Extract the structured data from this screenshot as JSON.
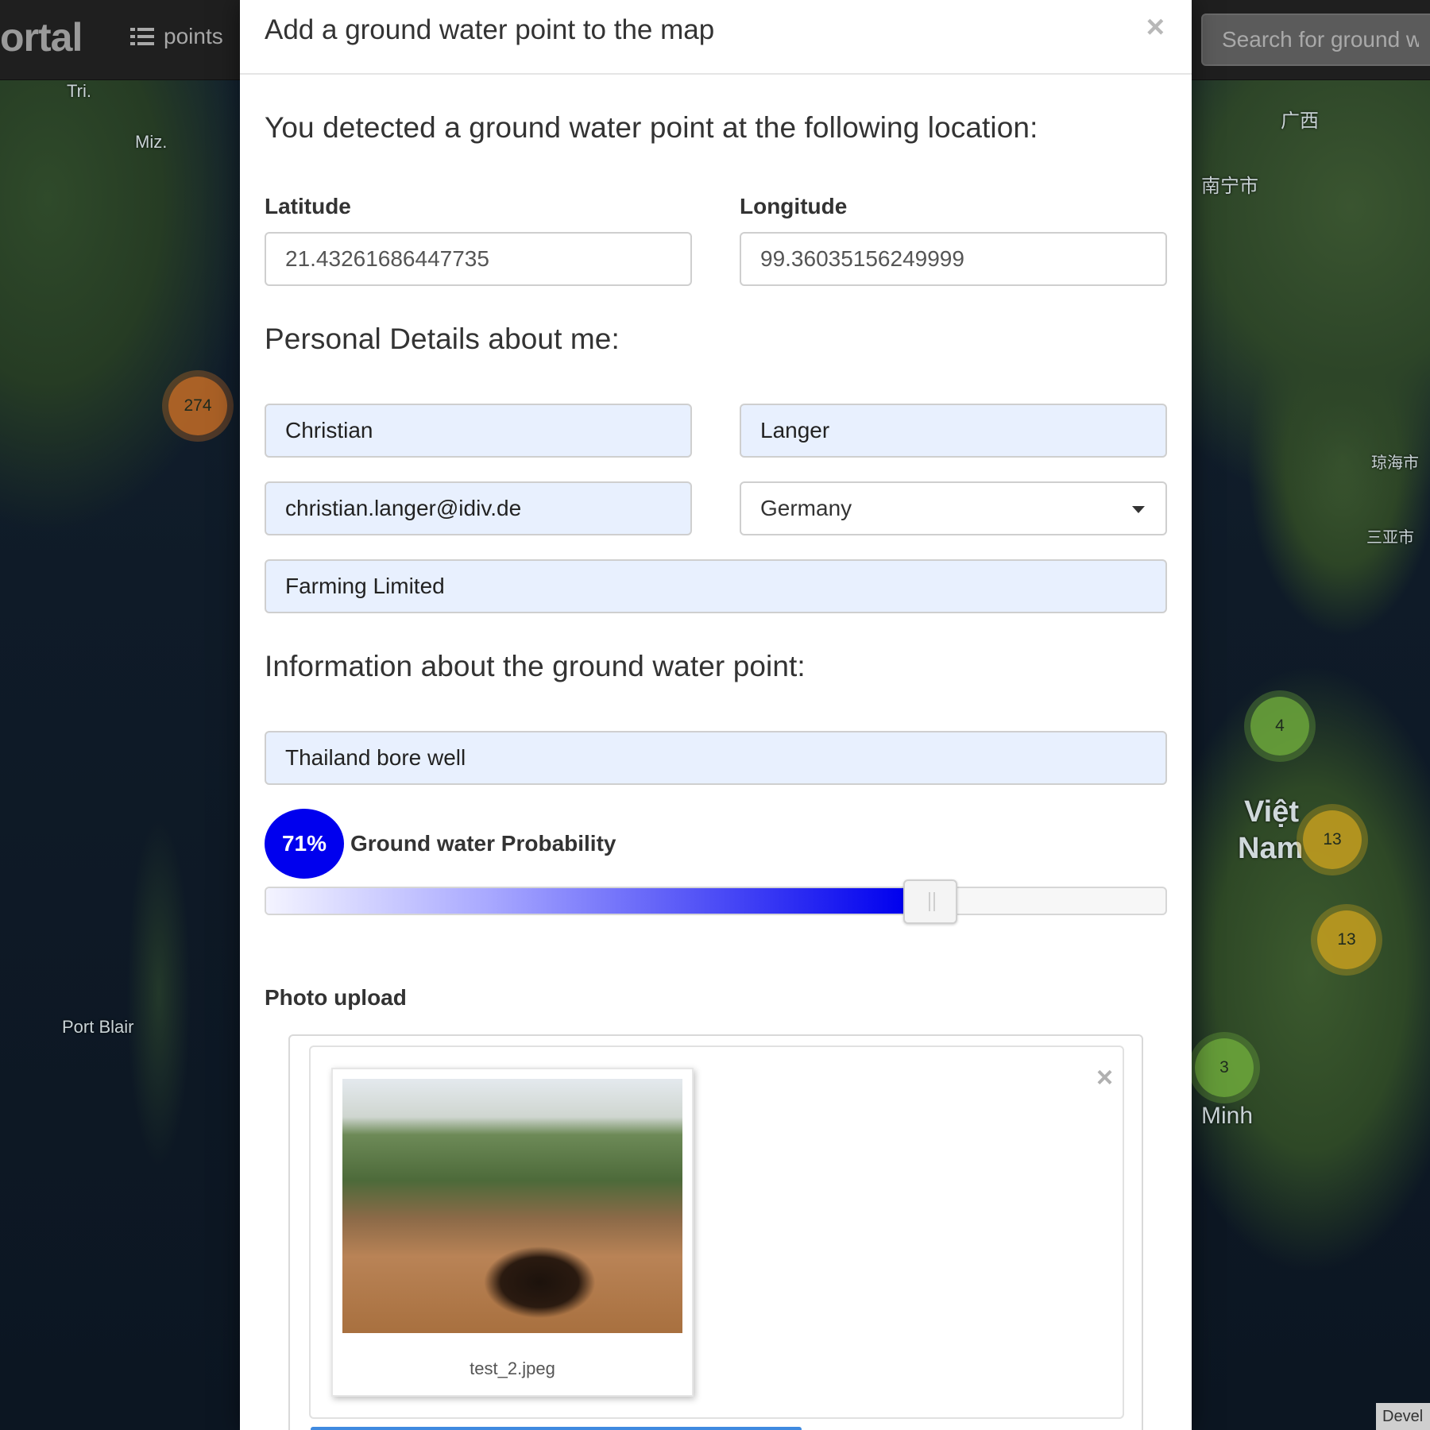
{
  "navbar": {
    "brand": "ortal",
    "points_label": "points",
    "search_placeholder": "Search for ground wa"
  },
  "map": {
    "labels": [
      "Tri.",
      "Miz.",
      "Port Blair",
      "广西",
      "南宁市",
      "琼海市",
      "三亚市",
      "Việt",
      "Nam",
      "Minh"
    ],
    "clusters": [
      {
        "count": "274",
        "color": "orange"
      },
      {
        "count": "4",
        "color": "green"
      },
      {
        "count": "13",
        "color": "yellow"
      },
      {
        "count": "13",
        "color": "yellow"
      },
      {
        "count": "3",
        "color": "green"
      }
    ],
    "dev_badge": "Devel"
  },
  "modal": {
    "title": "Add a ground water point to the map",
    "close": "×",
    "location_heading": "You detected a ground water point at the following location:",
    "latitude_label": "Latitude",
    "latitude_value": "21.43261686447735",
    "longitude_label": "Longitude",
    "longitude_value": "99.36035156249999",
    "personal_heading": "Personal Details about me:",
    "first_name": "Christian",
    "last_name": "Langer",
    "email": "christian.langer@idiv.de",
    "country": "Germany",
    "organization": "Farming Limited",
    "info_heading": "Information about the ground water point:",
    "point_name": "Thailand bore well",
    "probability_badge": "71%",
    "probability_label": "Ground water Probability",
    "probability_value": 71,
    "photo_label": "Photo upload",
    "upload_close": "×",
    "file_name": "test_2.jpeg"
  },
  "colors": {
    "accent_blue": "#0000ee",
    "filled_field": "#e8f0fe",
    "navbar": "#1f1f1f"
  }
}
